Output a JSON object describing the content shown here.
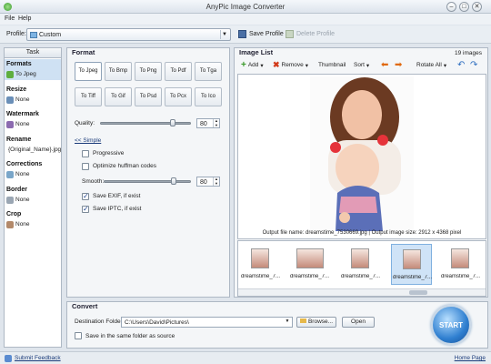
{
  "window": {
    "title": "AnyPic Image Converter"
  },
  "menu": {
    "file": "File",
    "help": "Help"
  },
  "profile": {
    "label": "Profile:",
    "value": "Custom",
    "save_label": "Save Profile",
    "delete_label": "Delete Profile"
  },
  "task": {
    "header": "Task",
    "sections": [
      {
        "heading": "Formats",
        "value": "To Jpeg",
        "icon": "jpeg-icon"
      },
      {
        "heading": "Resize",
        "value": "None",
        "icon": "resize-icon"
      },
      {
        "heading": "Watermark",
        "value": "None",
        "icon": "watermark-icon"
      },
      {
        "heading": "Rename",
        "value": "{Original_Name}.jpg",
        "icon": "rename-icon"
      },
      {
        "heading": "Corrections",
        "value": "None",
        "icon": "corrections-icon"
      },
      {
        "heading": "Border",
        "value": "None",
        "icon": "border-icon"
      },
      {
        "heading": "Crop",
        "value": "None",
        "icon": "crop-icon"
      }
    ]
  },
  "format": {
    "title": "Format",
    "buttons": [
      "To Jpeg",
      "To Bmp",
      "To Png",
      "To Pdf",
      "To Tga",
      "To Tiff",
      "To Gif",
      "To Psd",
      "To Pcx",
      "To Ico"
    ],
    "quality_label": "Quality:",
    "quality_value": "80",
    "quality_level": 0.8,
    "simple_link": "<< Simple",
    "progressive_label": "Progressive",
    "huffman_label": "Optimize huffman codes",
    "smooth_label": "Smooth:",
    "smooth_value": "80",
    "smooth_level": 0.8,
    "exif_label": "Save EXIF, if exist",
    "iptc_label": "Save IPTC, if exist"
  },
  "image_list": {
    "title": "Image List",
    "count": "19 images",
    "add_label": "Add",
    "remove_label": "Remove",
    "thumbnail_label": "Thumbnail",
    "sort_label": "Sort",
    "rotate_label": "Rotate All",
    "output_info": "Output file name: dreamstime_7530669.jpg | Output image size: 2912 x 4368 pixel",
    "thumbs": [
      "dreamstime_7...",
      "dreamstime_7...",
      "dreamstime_7...",
      "dreamstime_7...",
      "dreamstime_7..."
    ]
  },
  "convert": {
    "title": "Convert",
    "dest_label": "Destination Folder:",
    "dest_value": "C:\\Users\\David\\Pictures\\",
    "browse_label": "Browse...",
    "open_label": "Open",
    "same_folder_label": "Save in the same folder as source",
    "start_label": "START"
  },
  "status": {
    "feedback": "Submit Feedback",
    "home": "Home Page"
  },
  "colors": {
    "accent": "#2f7fd0",
    "selection": "#cfe1f3",
    "start": "#1e6fc4"
  }
}
